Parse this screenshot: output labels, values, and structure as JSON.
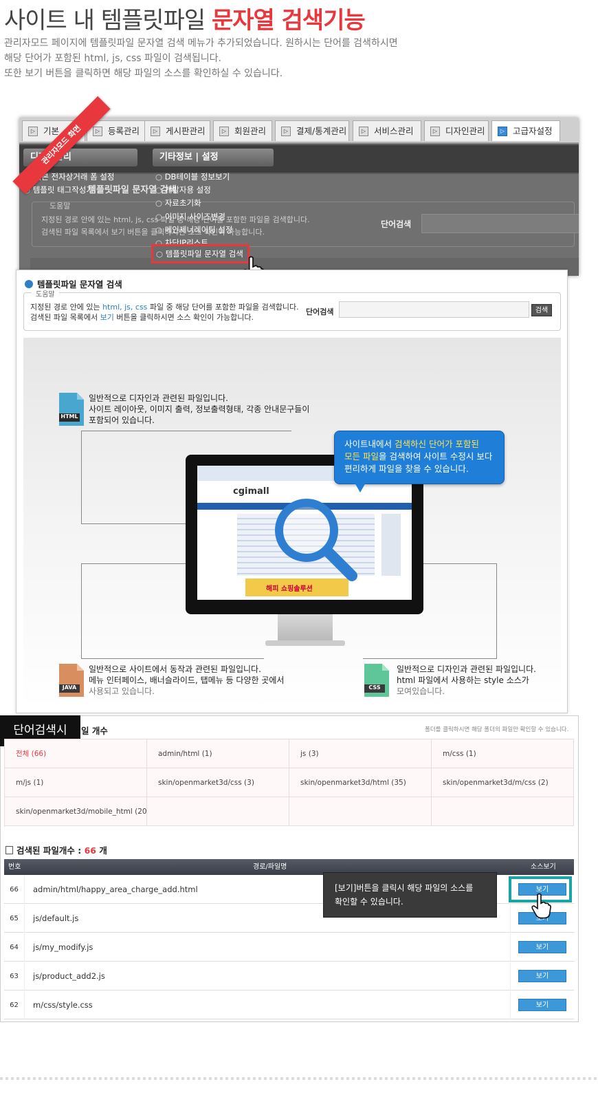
{
  "hero": {
    "title_plain": "사이트 내 템플릿파일 ",
    "title_highlight": "문자열 검색기능",
    "intro_lines": [
      "관리자모드 페이지에 템플릿파일 문자열 검색 메뉴가 추가되었습니다. 원하시는 단어를 검색하시면",
      "해당 단어가 포함된 html, js, css 파일이 검색됩니다.",
      "또한 보기 버튼을 클릭하면 해당 파일의 소스를 확인하실 수 있습니다."
    ]
  },
  "admin": {
    "tabs": [
      "기본",
      "등록관리",
      "게시판관리",
      "회원관리",
      "결제/통계관리",
      "서비스관리",
      "디자인관리",
      "고급자설정"
    ],
    "ribbon": "관리자모드 화면",
    "left_pill": "디자인관리",
    "right_pill": "기타정보 | 설정",
    "left_items": [
      "기본 전자상거래 폼 설정",
      "템플릿 태그작성기"
    ],
    "bg_title": "템플릿파일 문자열 검색",
    "bg_help_legend": "도움말",
    "bg_help_line1": "지정된 경로 안에 있는 html, js, css 파일 중 해당 단어를 포함한 파일을 검색합니다.",
    "bg_help_line2": "검색된 파일 목록에서 보기 버튼을 클릭하시면 소스 확인이 가능합니다.",
    "bg_search_label": "단어검색",
    "menu_items": [
      "DB테이블 정보보기",
      "개발자용 설정",
      "자료초기화",
      "이미지 사이즈변경",
      "메인제너레이팅 설정",
      "차단IP리스트"
    ],
    "menu_selected": "템플릿파일 문자열 검색"
  },
  "panel": {
    "title": "템플릿파일 문자열 검색",
    "help_legend": "도움말",
    "help_line1_a": "지정된 경로 안에 있는 ",
    "help_line1_b": "html, js, css",
    "help_line1_c": " 파일 중 해당 단어를 포함한 파일을 검색합니다.",
    "help_line2_a": "검색된 파일 목록에서 ",
    "help_line2_b": "보기",
    "help_line2_c": " 버튼을 클릭하시면 소스 확인이 가능합니다.",
    "search_label": "단어검색",
    "search_button": "검색",
    "html_icon": "HTML",
    "html_desc": [
      "일반적으로 디자인과 관련된 파일입니다.",
      "사이트 레이아웃, 이미지 출력, 정보출력형태, 각종 안내문구들이",
      "포함되어 있습니다."
    ],
    "java_icon": "JAVA",
    "java_desc": [
      "일반적으로 사이트에서 동작과 관련된 파일입니다.",
      "메뉴 인터페이스, 배너슬라이드, 탭메뉴 등 다양한 곳에서",
      "사용되고 있습니다."
    ],
    "css_icon": "CSS",
    "css_desc": [
      "일반적으로 디자인과 관련된 파일입니다.",
      "html 파일에서 사용하는 style 소스가",
      "모여있습니다."
    ],
    "bubble_a": "사이트내에서 ",
    "bubble_b": "검색하신 단어가 포함된",
    "bubble_c": "모든 파일",
    "bubble_d": "을 검색하여 사이트 수정시 보다",
    "bubble_e": "편리하게 파일을 찾을 수 있습니다.",
    "screen_logo": "cgimall",
    "screen_banner": "해피 쇼핑솔루션"
  },
  "result": {
    "black_label": "단어검색시",
    "folder_title": "일 개수",
    "folder_note": "폴더를 클릭하시면 해당 폴더의 파일만 확인할 수 있습니다.",
    "folders": [
      "전체 (66)",
      "admin/html (1)",
      "js (3)",
      "m/css (1)",
      "m/js (1)",
      "skin/openmarket3d/css (3)",
      "skin/openmarket3d/html (35)",
      "skin/openmarket3d/m/css (2)",
      "skin/openmarket3d/mobile_html (20)",
      "",
      "",
      ""
    ],
    "count_label": "검색된 파일개수 : ",
    "count_value": "66",
    "count_unit": " 개",
    "headers": [
      "번호",
      "경로/파일명",
      "소스보기"
    ],
    "rows": [
      {
        "num": "66",
        "path": "admin/html/happy_area_charge_add.html",
        "btn": "보기"
      },
      {
        "num": "65",
        "path": "js/default.js",
        "btn": "보기"
      },
      {
        "num": "64",
        "path": "js/my_modify.js",
        "btn": "보기"
      },
      {
        "num": "63",
        "path": "js/product_add2.js",
        "btn": "보기"
      },
      {
        "num": "62",
        "path": "m/css/style.css",
        "btn": "보기"
      }
    ],
    "tooltip_line1": "[보기]버튼을 클릭시 해당 파일의 소스를",
    "tooltip_line2": "확인할 수 있습니다."
  },
  "colors": {
    "accent_red": "#e8383d",
    "blue": "#2e7fc6",
    "teal": "#1aa5a5"
  }
}
